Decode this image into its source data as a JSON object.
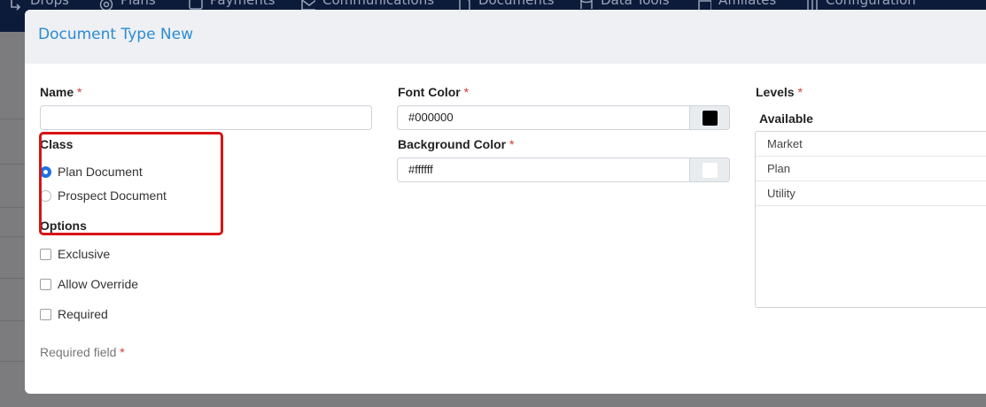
{
  "nav": {
    "items": [
      {
        "label": "Drops",
        "icon": "arrow-down-icon"
      },
      {
        "label": "Plans",
        "icon": "target-icon"
      },
      {
        "label": "Payments",
        "icon": "payments-icon"
      },
      {
        "label": "Communications",
        "icon": "mail-icon"
      },
      {
        "label": "Documents",
        "icon": "document-icon"
      },
      {
        "label": "Data Tools",
        "icon": "database-icon"
      },
      {
        "label": "Affiliates",
        "icon": "building-icon"
      },
      {
        "label": "Configuration",
        "icon": "sliders-icon"
      }
    ]
  },
  "modal": {
    "title": "Document Type New",
    "required_mark": "*",
    "name": {
      "label": "Name",
      "value": ""
    },
    "class": {
      "label": "Class",
      "options": [
        {
          "label": "Plan Document",
          "selected": true
        },
        {
          "label": "Prospect Document",
          "selected": false
        }
      ]
    },
    "options": {
      "label": "Options",
      "items": [
        {
          "label": "Exclusive",
          "checked": false
        },
        {
          "label": "Allow Override",
          "checked": false
        },
        {
          "label": "Required",
          "checked": false
        }
      ]
    },
    "required_note": "Required field",
    "font_color": {
      "label": "Font Color",
      "value": "#000000",
      "swatch": "#000000"
    },
    "background_color": {
      "label": "Background Color",
      "value": "#ffffff",
      "swatch": "#ffffff"
    },
    "levels": {
      "label": "Levels",
      "available_label": "Available",
      "available": [
        "Market",
        "Plan",
        "Utility"
      ]
    }
  },
  "colors": {
    "accent": "#2a8bd6",
    "radio_selected": "#1f6fe5",
    "highlight_box": "#d81414",
    "required": "#d33333"
  }
}
